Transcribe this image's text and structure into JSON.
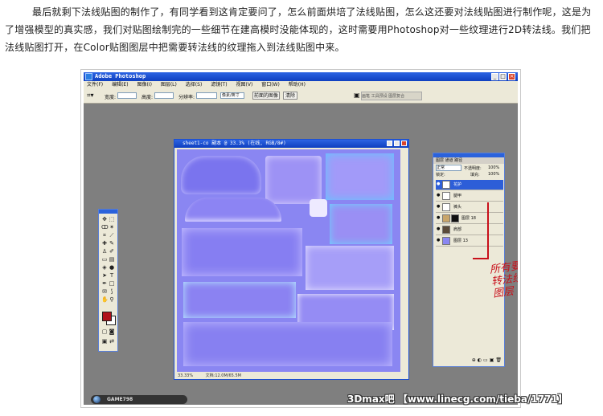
{
  "article": {
    "paragraph": "最后就剩下法线贴图的制作了，有同学看到这肯定要问了，怎么前面烘培了法线贴图，怎么这还要对法线贴图进行制作呢，这是为了增强模型的真实感，我们对贴图绘制完的一些细节在建高模时没能体现的，这时需要用Photoshop对一些纹理进行2D转法线。我们把法线贴图打开，在Color贴图图层中把需要转法线的纹理拖入到法线贴图中来。"
  },
  "photoshop": {
    "app_title": "Adobe Photoshop",
    "menu": [
      "文件(F)",
      "编辑(E)",
      "图像(I)",
      "图层(L)",
      "选择(S)",
      "滤镜(T)",
      "视图(V)",
      "窗口(W)",
      "帮助(H)"
    ],
    "options": {
      "width_label": "宽度:",
      "height_label": "高度:",
      "resolution_label": "分辨率:",
      "units_value": "像素/英寸",
      "front_image_button": "前面的图像",
      "clear_button": "清除",
      "palette_tabs": "画笔 工具预设 图层复合"
    },
    "document": {
      "title": "sheet1-co 副本 @ 33.3% (在线, RGB/8#)",
      "zoom": "33.33%",
      "doc_info": "文档:12.0M/65.5M"
    },
    "layers_panel": {
      "tabs": "图层  通道  路径",
      "blend_mode": "正常",
      "opacity_label": "不透明度:",
      "opacity_value": "100%",
      "fill_label": "填充:",
      "fill_value": "100%",
      "lock_label": "锁定:",
      "layers": [
        {
          "name": "花护",
          "selected": true
        },
        {
          "name": "腿甲",
          "selected": false
        },
        {
          "name": "裤头",
          "selected": false
        },
        {
          "name": "图层 18",
          "selected": false
        },
        {
          "name": "肩部",
          "selected": false
        },
        {
          "name": "图层 13",
          "selected": false
        }
      ]
    },
    "annotation": "所有要转法线图层",
    "site_logo": "GAME798 WWW.GAME798.COM"
  },
  "watermark": "3Dmax吧 【www.linecg.com/tieba/1771】"
}
